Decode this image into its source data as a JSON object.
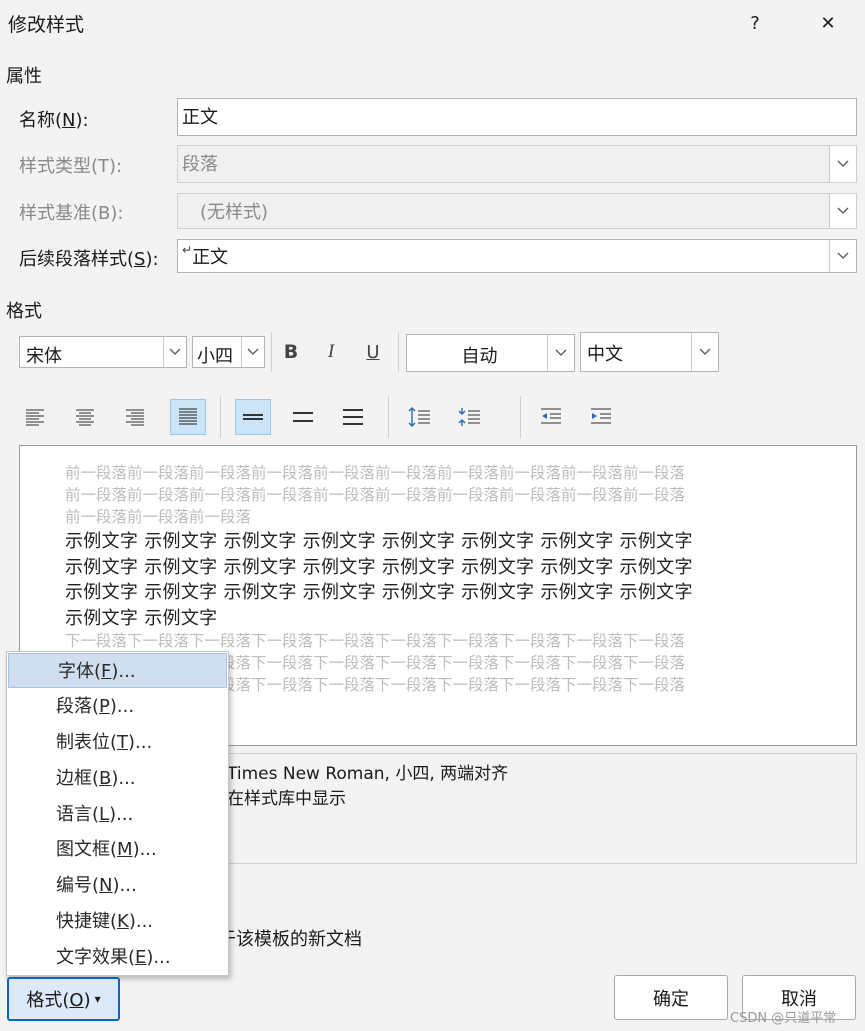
{
  "dialog": {
    "title": "修改样式",
    "help": "?",
    "close": "✕"
  },
  "properties": {
    "section": "属性",
    "name_label": "名称(N):",
    "name_value": "正文",
    "type_label": "样式类型(T):",
    "type_value": "段落",
    "based_label": "样式基准(B):",
    "based_value": "(无样式)",
    "next_label": "后续段落样式(S):",
    "next_mark": "↵",
    "next_value": "正文"
  },
  "format": {
    "section": "格式",
    "font": "宋体",
    "size": "小四",
    "bold": "B",
    "italic": "I",
    "underline": "U",
    "color": "自动",
    "script": "中文"
  },
  "preview": {
    "prev_lines": [
      "前一段落前一段落前一段落前一段落前一段落前一段落前一段落前一段落前一段落前一段落",
      "前一段落前一段落前一段落前一段落前一段落前一段落前一段落前一段落前一段落前一段落",
      "前一段落前一段落前一段落"
    ],
    "sample_lines": [
      "示例文字 示例文字 示例文字 示例文字 示例文字 示例文字 示例文字 示例文字",
      "示例文字 示例文字 示例文字 示例文字 示例文字 示例文字 示例文字 示例文字",
      "示例文字 示例文字 示例文字 示例文字 示例文字 示例文字 示例文字 示例文字",
      "示例文字 示例文字"
    ],
    "next_lines": [
      "下一段落下一段落下一段落下一段落下一段落下一段落下一段落下一段落下一段落下一段落",
      "下一段落下一段落下一段落下一段落下一段落下一段落下一段落下一段落下一段落下一段落",
      "下一段落下一段落下一段落下一段落下一段落下一段落下一段落下一段落下一段落下一段落"
    ]
  },
  "description": {
    "line1": "Times New Roman, 小四, 两端对齐",
    "line2": "在样式库中显示"
  },
  "template_text": "于该模板的新文档",
  "menu": {
    "items": [
      {
        "pre": "字体(",
        "key": "F",
        "post": ")..."
      },
      {
        "pre": "段落(",
        "key": "P",
        "post": ")..."
      },
      {
        "pre": "制表位(",
        "key": "T",
        "post": ")..."
      },
      {
        "pre": "边框(",
        "key": "B",
        "post": ")..."
      },
      {
        "pre": "语言(",
        "key": "L",
        "post": ")..."
      },
      {
        "pre": "图文框(",
        "key": "M",
        "post": ")..."
      },
      {
        "pre": "编号(",
        "key": "N",
        "post": ")..."
      },
      {
        "pre": "快捷键(",
        "key": "K",
        "post": ")..."
      },
      {
        "pre": "文字效果(",
        "key": "E",
        "post": ")..."
      }
    ]
  },
  "buttons": {
    "format": "格式(O)",
    "format_arrow": "▾",
    "ok": "确定",
    "cancel": "取消"
  },
  "watermark": "CSDN @只道平常"
}
